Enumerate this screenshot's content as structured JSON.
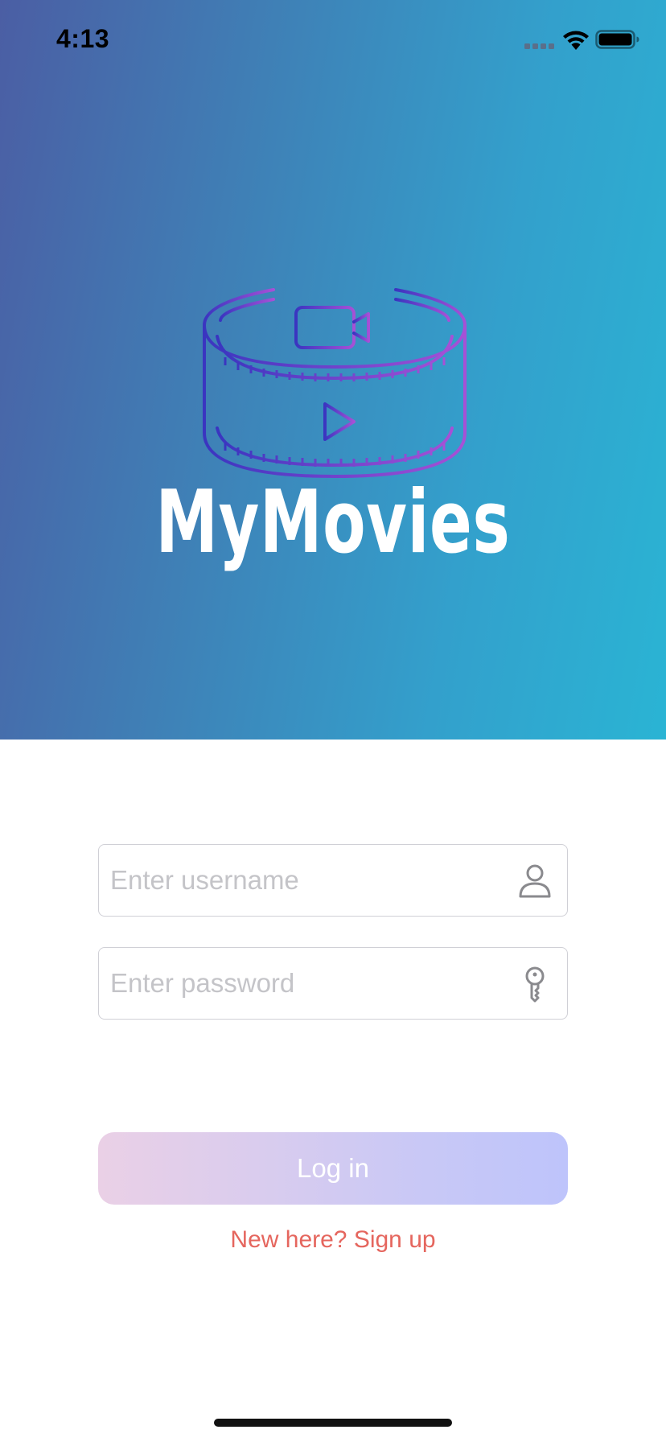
{
  "status_bar": {
    "time": "4:13"
  },
  "app": {
    "title": "MyMovies",
    "logo_icon": "film-reel-camera-play-icon",
    "colors": {
      "hero_gradient_start": "#4b5ea4",
      "hero_gradient_end": "#2ab4d4",
      "logo_gradient_start": "#3a35c0",
      "logo_gradient_end": "#a651d6",
      "button_gradient_start": "#ead0e6",
      "button_gradient_end": "#bec4fb",
      "link": "#e5665e"
    }
  },
  "form": {
    "username": {
      "placeholder": "Enter username",
      "value": "",
      "icon": "person-icon"
    },
    "password": {
      "placeholder": "Enter password",
      "value": "",
      "icon": "key-icon"
    },
    "login_label": "Log in",
    "signup_label": "New here? Sign up"
  }
}
